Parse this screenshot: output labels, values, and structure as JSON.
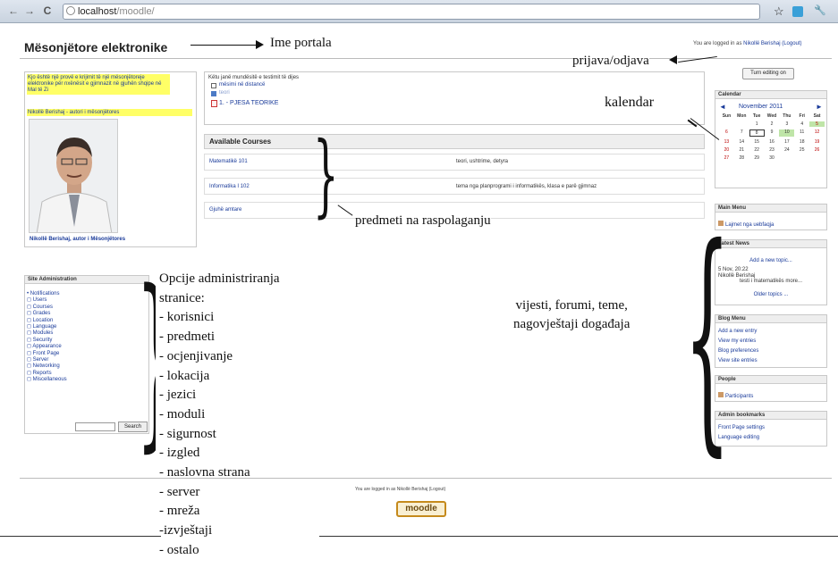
{
  "browser": {
    "url_host": "localhost",
    "url_path": "/moodle/",
    "back_glyph": "←",
    "forward_glyph": "→",
    "reload_glyph": "C",
    "star_glyph": "☆",
    "wrench_glyph": "🔧"
  },
  "header": {
    "portal_title": "Mësonjëtore elektronike",
    "login_prefix": "You are logged in as",
    "login_user": "Nikollë Berishaj",
    "logout_label": "(Logout)"
  },
  "annotations": {
    "portal_name": "Ime portala",
    "login_logout": "prijava/odjava",
    "calendar": "kalendar",
    "courses": "predmeti na raspolaganju",
    "news": [
      "vijesti, forumi, teme,",
      "nagovještaji događaja"
    ],
    "admin_options": [
      "Opcije administriranja",
      "stranice:",
      "- korisnici",
      "- predmeti",
      "- ocjenjivanje",
      "- lokacija",
      "- jezici",
      "- moduli",
      "- sigurnost",
      "- izgled",
      "- naslovna strana",
      "- server",
      "- mreža",
      "-izvještaji",
      "- ostalo"
    ]
  },
  "featured": {
    "text1": "Kjo është një provë e krijimit të një mësonjëtoreje elektronike për nxënësit e gjimnazit në gjuhën shqipe në Mal të Zi",
    "text2": "Nikollë Berishaj - autori i mësonjëtores",
    "caption": "Nikollë Berishaj, autor i Mësonjëtores"
  },
  "center": {
    "intro": "Këtu janë mundësitë e testimit të dijes",
    "link1": "mësimi në distancë",
    "link2": "teori",
    "link3": "1. - PJESA TEORIKE"
  },
  "courses": {
    "heading": "Available Courses",
    "items": [
      {
        "name": "Matematikë 101",
        "desc": "teori, ushtrime, detyra"
      },
      {
        "name": "Informatika I 102",
        "desc": "tema nga planprogrami i informatikës, klasa e parë gjimnaz"
      },
      {
        "name": "Gjuhë amtare",
        "desc": ""
      }
    ]
  },
  "admin": {
    "heading": "Site Administration",
    "items": [
      "Notifications",
      "Users",
      "Courses",
      "Grades",
      "Location",
      "Language",
      "Modules",
      "Security",
      "Appearance",
      "Front Page",
      "Server",
      "Networking",
      "Reports",
      "Miscellaneous"
    ],
    "search_label": "Search"
  },
  "sidebar": {
    "edit_button": "Turn editing on",
    "calendar": {
      "heading": "Calendar",
      "month": "November 2011",
      "prev": "◄",
      "next": "►",
      "days": [
        "Sun",
        "Mon",
        "Tue",
        "Wed",
        "Thu",
        "Fri",
        "Sat"
      ],
      "weeks": [
        [
          "",
          "",
          "1",
          "2",
          "3",
          "4",
          "5"
        ],
        [
          "6",
          "7",
          "8",
          "9",
          "10",
          "11",
          "12"
        ],
        [
          "13",
          "14",
          "15",
          "16",
          "17",
          "18",
          "19"
        ],
        [
          "20",
          "21",
          "22",
          "23",
          "24",
          "25",
          "26"
        ],
        [
          "27",
          "28",
          "29",
          "30",
          "",
          "",
          ""
        ]
      ]
    },
    "main_menu": {
      "heading": "Main Menu",
      "item": "Lajmet nga uebfaqja"
    },
    "latest_news": {
      "heading": "Latest News",
      "add": "Add a new topic...",
      "date": "5 Nov, 20:22",
      "author": "Nikollë Berishaj",
      "text": "testi i matematikës more...",
      "older": "Older topics ..."
    },
    "blog_menu": {
      "heading": "Blog Menu",
      "items": [
        "Add a new entry",
        "View my entries",
        "Blog preferences",
        "View site entries"
      ]
    },
    "people": {
      "heading": "People",
      "item": "Participants"
    },
    "admin_bookmarks": {
      "heading": "Admin bookmarks",
      "items": [
        "Front Page settings",
        "Language editing"
      ]
    }
  },
  "footer": {
    "login_text": "You are logged in as Nikollë Berishaj (Logout)",
    "logo_text": "moodle"
  },
  "colors": {
    "link": "#1a3b9a",
    "highlight": "#ffff66",
    "weekend": "#bb0000"
  }
}
